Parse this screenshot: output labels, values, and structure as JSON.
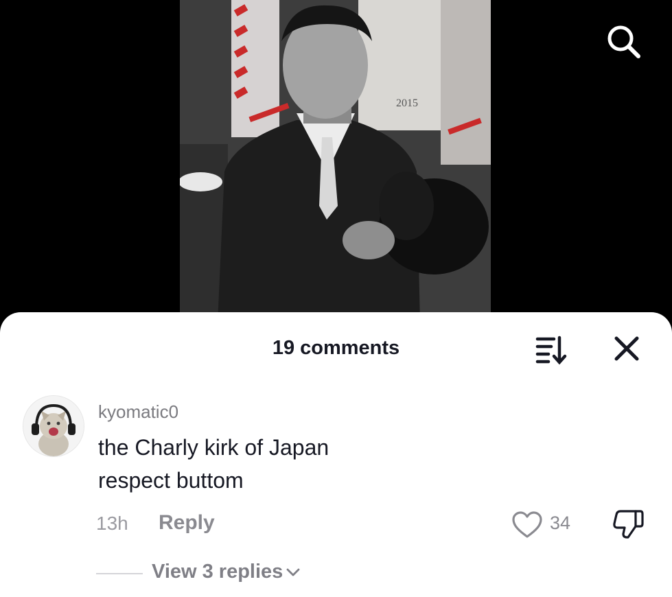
{
  "video": {
    "search_icon": "search-icon",
    "poster_text": "2015"
  },
  "comments_sheet": {
    "title": "19 comments",
    "sort_icon": "sort-icon",
    "close_icon": "close-icon"
  },
  "comment": {
    "username": "kyomatic0",
    "text_line_1": "the Charly kirk of Japan",
    "text_line_2": "respect buttom",
    "time": "13h",
    "reply_label": "Reply",
    "like_count": "34",
    "view_replies_label": "View 3 replies"
  },
  "colors": {
    "text_primary": "#161823",
    "text_secondary": "#8a8a90",
    "sheet_bg": "#ffffff"
  }
}
